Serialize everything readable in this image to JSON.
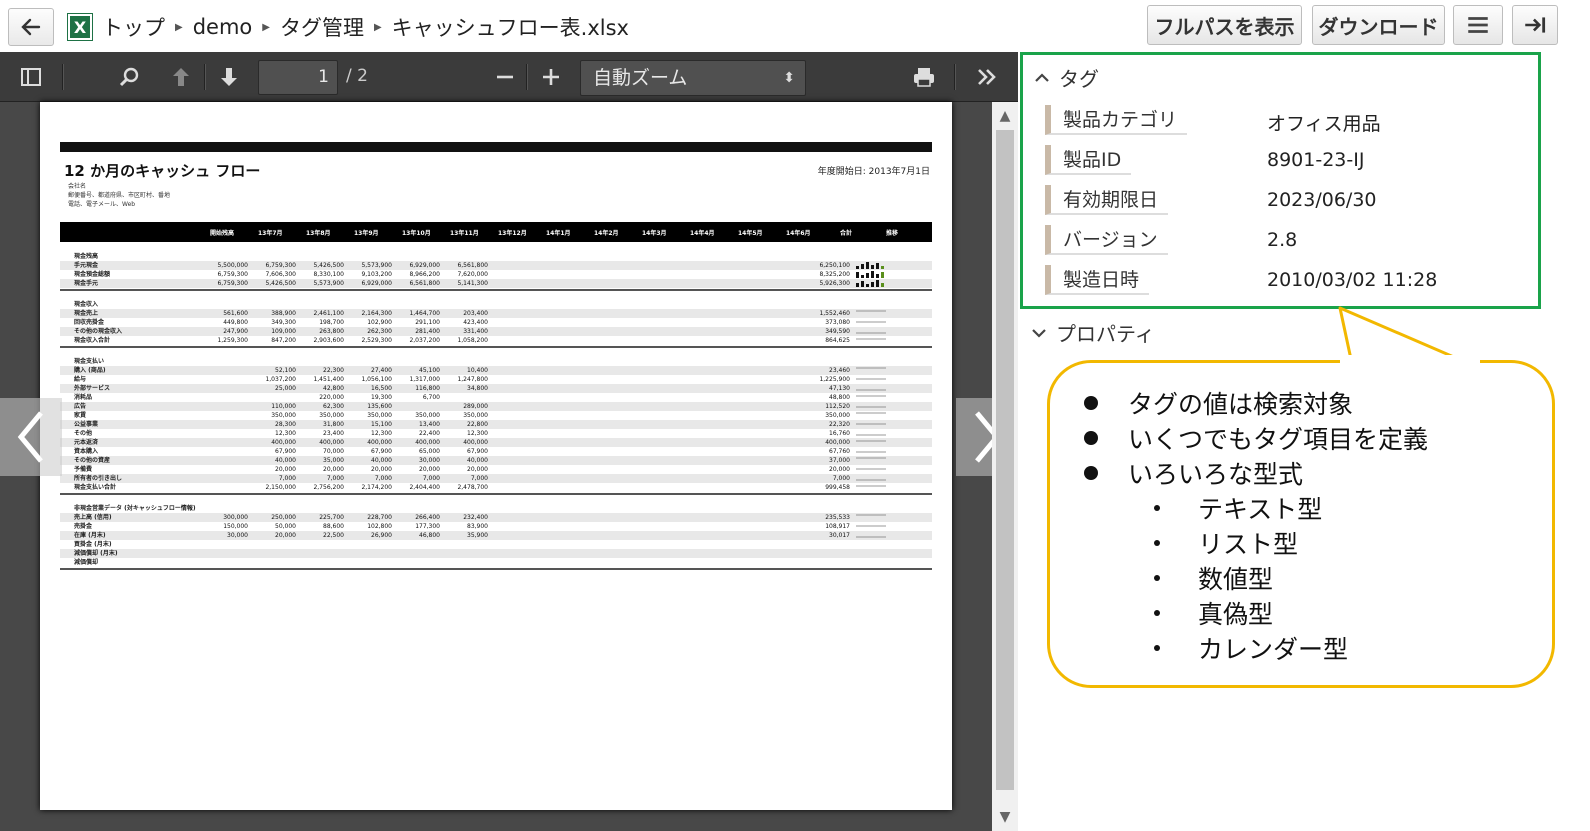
{
  "breadcrumb": {
    "items": [
      "トップ",
      "demo",
      "タグ管理",
      "キャッシュフロー表.xlsx"
    ]
  },
  "toolbar_buttons": {
    "full_path": "フルパスを表示",
    "download": "ダウンロード"
  },
  "viewer": {
    "page_current": "1",
    "page_total": "/ 2",
    "zoom": "自動ズーム"
  },
  "sheet": {
    "title": "12 か月のキャッシュ フロー",
    "start_date": "年度開始日:   2013年7月1日",
    "company": [
      "会社名",
      "郵便番号、都道府県、市区町村、番地",
      "電話、電子メール、Web"
    ],
    "months": [
      "開始残高",
      "13年7月",
      "13年8月",
      "13年9月",
      "13年10月",
      "13年11月",
      "13年12月",
      "14年1月",
      "14年2月",
      "14年3月",
      "14年4月",
      "14年5月",
      "14年6月",
      "合計",
      "推移"
    ],
    "sections": [
      {
        "heading": "現金残高",
        "rows": [
          {
            "label": "手元現金",
            "values": [
              "5,500,000",
              "6,759,300",
              "5,426,500",
              "5,573,900",
              "6,929,000",
              "6,561,800"
            ],
            "total": "6,250,100"
          },
          {
            "label": "現金預金総額",
            "values": [
              "6,759,300",
              "7,606,300",
              "8,330,100",
              "9,103,200",
              "8,966,200",
              "7,620,000"
            ],
            "total": "8,325,200"
          },
          {
            "label": "現金手元",
            "values": [
              "6,759,300",
              "5,426,500",
              "5,573,900",
              "6,929,000",
              "6,561,800",
              "5,141,300"
            ],
            "total": "5,926,300"
          }
        ]
      },
      {
        "heading": "現金収入",
        "rows": [
          {
            "label": "現金売上",
            "values": [
              "561,600",
              "388,900",
              "2,461,100",
              "2,164,300",
              "1,464,700",
              "203,400"
            ],
            "total": "1,552,460"
          },
          {
            "label": "回収売掛金",
            "values": [
              "449,800",
              "349,300",
              "198,700",
              "102,900",
              "291,100",
              "423,400"
            ],
            "total": "373,080"
          },
          {
            "label": "その他の現金収入",
            "values": [
              "247,900",
              "109,000",
              "263,800",
              "262,300",
              "281,400",
              "331,400"
            ],
            "total": "349,590"
          },
          {
            "label": "現金収入合計",
            "values": [
              "1,259,300",
              "847,200",
              "2,903,600",
              "2,529,300",
              "2,037,200",
              "1,058,200"
            ],
            "total": "864,625"
          }
        ]
      },
      {
        "heading": "現金支払い",
        "rows": [
          {
            "label": "購入 (商品)",
            "values": [
              "",
              "52,100",
              "22,300",
              "27,400",
              "45,100",
              "10,400"
            ],
            "total": "23,460"
          },
          {
            "label": "給与",
            "values": [
              "",
              "1,037,200",
              "1,451,400",
              "1,056,100",
              "1,317,000",
              "1,247,800"
            ],
            "total": "1,225,900"
          },
          {
            "label": "外部サービス",
            "values": [
              "",
              "25,000",
              "42,800",
              "16,500",
              "116,800",
              "34,800"
            ],
            "total": "47,130"
          },
          {
            "label": "消耗品",
            "values": [
              "",
              "",
              "220,000",
              "19,300",
              "6,700",
              ""
            ],
            "total": "48,800"
          },
          {
            "label": "広告",
            "values": [
              "",
              "110,000",
              "62,300",
              "135,600",
              "",
              "289,000"
            ],
            "total": "112,520"
          },
          {
            "label": "家賃",
            "values": [
              "",
              "350,000",
              "350,000",
              "350,000",
              "350,000",
              "350,000"
            ],
            "total": "350,000"
          },
          {
            "label": "公益事業",
            "values": [
              "",
              "28,300",
              "31,800",
              "15,100",
              "13,400",
              "22,800"
            ],
            "total": "22,320"
          },
          {
            "label": "その他",
            "values": [
              "",
              "12,300",
              "23,400",
              "12,300",
              "22,400",
              "12,300"
            ],
            "total": "16,760"
          },
          {
            "label": "元本返済",
            "values": [
              "",
              "400,000",
              "400,000",
              "400,000",
              "400,000",
              "400,000"
            ],
            "total": "400,000"
          },
          {
            "label": "資本購入",
            "values": [
              "",
              "67,900",
              "70,000",
              "67,900",
              "65,000",
              "67,900"
            ],
            "total": "67,760"
          },
          {
            "label": "その他の資産",
            "values": [
              "",
              "40,000",
              "35,000",
              "40,000",
              "30,000",
              "40,000"
            ],
            "total": "37,000"
          },
          {
            "label": "予備費",
            "values": [
              "",
              "20,000",
              "20,000",
              "20,000",
              "20,000",
              "20,000"
            ],
            "total": "20,000"
          },
          {
            "label": "所有者の引き出し",
            "values": [
              "",
              "7,000",
              "7,000",
              "7,000",
              "7,000",
              "7,000"
            ],
            "total": "7,000"
          },
          {
            "label": "現金支払い合計",
            "values": [
              "",
              "2,150,000",
              "2,756,200",
              "2,174,200",
              "2,404,400",
              "2,478,700"
            ],
            "total": "999,458"
          }
        ]
      },
      {
        "heading": "非現金営業データ (対キャッシュフロー情報)",
        "rows": [
          {
            "label": "売上高 (信用)",
            "values": [
              "300,000",
              "250,000",
              "225,700",
              "228,700",
              "266,400",
              "232,400"
            ],
            "total": "235,533"
          },
          {
            "label": "売掛金",
            "values": [
              "150,000",
              "50,000",
              "88,600",
              "102,800",
              "177,300",
              "83,900"
            ],
            "total": "108,917"
          },
          {
            "label": "在庫 (月末)",
            "values": [
              "30,000",
              "20,000",
              "22,500",
              "26,900",
              "46,800",
              "35,900"
            ],
            "total": "30,017"
          },
          {
            "label": "買掛金 (月末)",
            "values": [
              "",
              "",
              "",
              "",
              "",
              ""
            ],
            "total": ""
          },
          {
            "label": "減価償却 (月末)",
            "values": [
              "",
              "",
              "",
              "",
              "",
              ""
            ],
            "total": ""
          },
          {
            "label": "減価償却",
            "values": [
              "",
              "",
              "",
              "",
              "",
              ""
            ],
            "total": ""
          }
        ]
      }
    ]
  },
  "tags_panel": {
    "heading": "タグ",
    "rows": [
      {
        "key": "製品カテゴリ",
        "value": "オフィス用品"
      },
      {
        "key": "製品ID",
        "value": "8901-23-IJ"
      },
      {
        "key": "有効期限日",
        "value": "2023/06/30"
      },
      {
        "key": "バージョン",
        "value": "2.8"
      },
      {
        "key": "製造日時",
        "value": "2010/03/02 11:28"
      }
    ]
  },
  "properties_panel": {
    "heading": "プロパティ"
  },
  "callout": {
    "bullets": [
      "タグの値は検索対象",
      "いくつでもタグ項目を定義",
      "いろいろな型式"
    ],
    "sub_bullets": [
      "テキスト型",
      "リスト型",
      "数値型",
      "真偽型",
      "カレンダー型"
    ]
  },
  "colors": {
    "tag_border": "#1aa34a",
    "callout_border": "#f2b800",
    "viewer_bg": "#484848"
  }
}
